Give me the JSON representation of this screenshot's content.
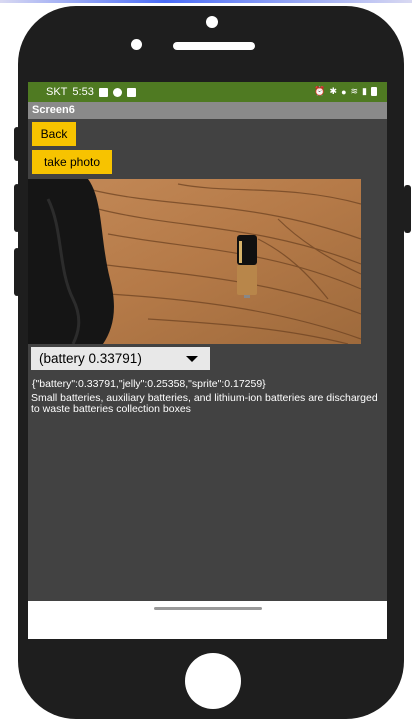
{
  "status_bar": {
    "carrier": "SKT",
    "time": "5:53",
    "right_icons": [
      "alarm-icon",
      "bluetooth-icon",
      "location-icon",
      "wifi-icon",
      "signal-icon",
      "battery-icon"
    ]
  },
  "app": {
    "screen_title": "Screen6",
    "back_label": "Back",
    "take_photo_label": "take photo",
    "dropdown_value": "(battery 0.33791)",
    "result_json": "{\"battery\":0.33791,\"jelly\":0.25358,\"sprite\":0.17259}",
    "message": "Small batteries, auxiliary batteries, and lithium-ion batteries are discharged to waste batteries collection boxes"
  },
  "colors": {
    "phone_body": "#1e1e1e",
    "status_bar": "#4f7a22",
    "title_bar": "#8a8a8a",
    "content_bg": "#424242",
    "button_accent": "#f7c300"
  }
}
